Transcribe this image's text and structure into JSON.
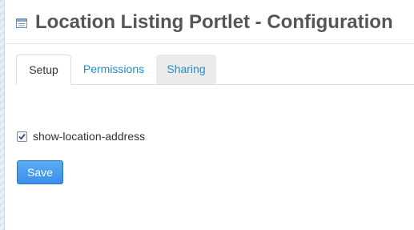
{
  "header": {
    "title": "Location Listing Portlet - Configuration",
    "icon": "portlet-config-icon"
  },
  "tabs": [
    {
      "label": "Setup",
      "state": "active"
    },
    {
      "label": "Permissions",
      "state": "inactive"
    },
    {
      "label": "Sharing",
      "state": "inactive-shaded"
    }
  ],
  "form": {
    "checkbox": {
      "label": "show-location-address",
      "checked": true
    },
    "save_label": "Save"
  },
  "colors": {
    "link": "#1f8fc6",
    "button": "#3a8ee8",
    "title": "#555555"
  }
}
